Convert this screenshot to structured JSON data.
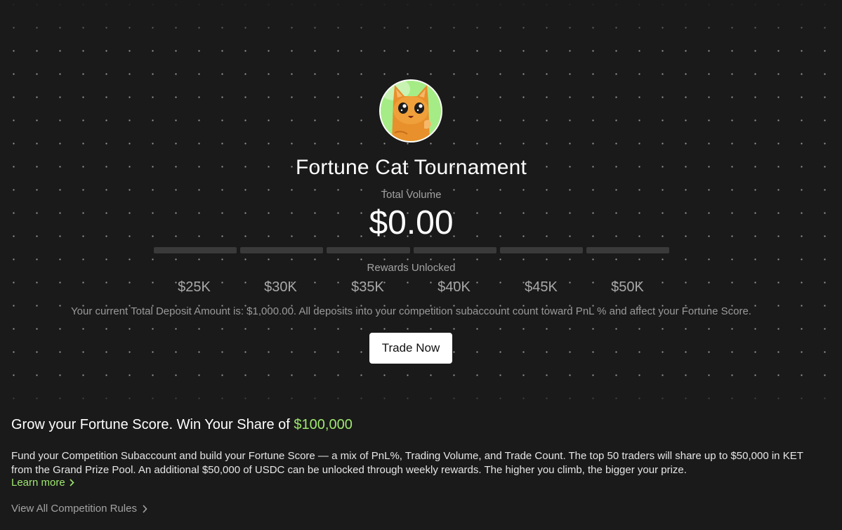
{
  "tournament": {
    "title": "Fortune Cat Tournament",
    "total_volume_label": "Total Volume",
    "total_volume_value": "$0.00",
    "volume_progress_fraction": 0,
    "rewards_label": "Rewards Unlocked",
    "milestones": [
      "$25K",
      "$30K",
      "$35K",
      "$40K",
      "$45K",
      "$50K"
    ],
    "deposit_note": "Your current Total Deposit Amount is: $1,000.00. All deposits into your competition subaccount count toward PnL % and affect your Fortune Score.",
    "trade_button_label": "Trade Now",
    "avatar_icon": "fortune-cat-avatar-icon"
  },
  "info": {
    "heading_prefix": "Grow your Fortune Score. Win Your Share of ",
    "heading_amount": "$100,000",
    "body": "Fund your Competition Subaccount and build your Fortune Score — a mix of PnL%, Trading Volume, and Trade Count. The top 50 traders will share up to $50,000 in KET from the Grand Prize Pool. An additional $50,000 of USDC can be unlocked through weekly rewards. The higher you climb, the bigger your prize.",
    "learn_more_label": "Learn more",
    "rules_link_label": "View All Competition Rules"
  },
  "colors": {
    "background": "#1a1a1a",
    "accent_green": "#9fe870",
    "progress_track": "#3a3a3a",
    "muted_text": "#a3a3a3"
  }
}
